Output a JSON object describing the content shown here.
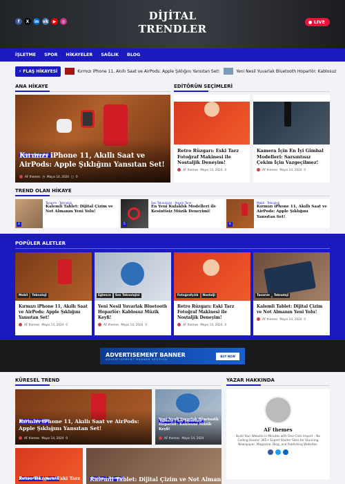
{
  "header": {
    "logo_line1": "DİJİTAL",
    "logo_line2": "TRENDLER",
    "live": "LIVE",
    "social": [
      "f",
      "X",
      "in",
      "vk",
      "▶",
      "◎"
    ]
  },
  "nav": [
    "İŞLETME",
    "SPOR",
    "HİKAYELER",
    "SAĞLIK",
    "BLOG"
  ],
  "ticker": {
    "label": "⚡ FLAŞ HİKAYESİ",
    "items": [
      "Kırmızı iPhone 11, Akıllı Saat ve AirPods: Apple Şıklığını Yansıtan Set!",
      "Yeni Nesil Yuvarlak Bluetooth Hoparlör: Kablosuz"
    ]
  },
  "sections": {
    "main_story": "ANA HİKAYE",
    "editors": "EDİTÖRÜN SEÇİMLERİ",
    "trending": "TREND OLAN HİKAYE",
    "popular": "POPÜLER ALETLER",
    "global": "KÜRESEL TREND",
    "about": "YAZAR HAKKINDA"
  },
  "main": {
    "cats": [
      "Mobil",
      "Teknoloji"
    ],
    "title": "Kırmızı iPhone 11, Akıllı Saat ve AirPods: Apple Şıklığını Yansıtan Set!",
    "author": "AF themes",
    "date": "Mayıs 14, 2024",
    "comments": "0"
  },
  "editors": [
    {
      "title": "Retro Rüzgarı: Eski Tarz Fotoğraf Makinesi ile Nostaljik Deneyim!",
      "author": "AF themes",
      "date": "Mayıs 14, 2024",
      "comments": "0"
    },
    {
      "title": "Kamera İçin En İyi Gimbal Modelleri: Sarsıntısız Çekim İçin Vazgeçilmez!",
      "author": "AF themes",
      "date": "Mayıs 14, 2024",
      "comments": "0"
    }
  ],
  "trending": [
    {
      "num": "4",
      "cats": "Tasarım · Teknoloji",
      "title": "Kalemli Tablet: Dijital Çizim ve Not Almanın Yeni Yolu!"
    },
    {
      "num": "5",
      "cats": "Ses Teknolojisi · Yaşam Tarzı",
      "title": "En Yeni Kulaklık Modelleri ile Kesintisiz Müzik Deneyimi!"
    },
    {
      "num": "6",
      "cats": "Mobil · Teknoloji",
      "title": "Kırmızı iPhone 11, Akıllı Saat ve AirPods: Apple Şıklığını Yansıtan Set!"
    }
  ],
  "popular": [
    {
      "cats": [
        "Mobil",
        "Teknoloji"
      ],
      "title": "Kırmızı iPhone 11, Akıllı Saat ve AirPods: Apple Şıklığını Yansıtan Set!",
      "author": "AF themes",
      "date": "Mayıs 14, 2024",
      "comments": "0"
    },
    {
      "cats": [
        "Eğlence",
        "Ses Teknolojisi"
      ],
      "title": "Yeni Nesil Yuvarlak Bluetooth Hoparlör: Kablosuz Müzik Keyfi!",
      "author": "AF themes",
      "date": "Mayıs 14, 2024",
      "comments": "0"
    },
    {
      "cats": [
        "Fotoğrafçılık",
        "Nostalji"
      ],
      "title": "Retro Rüzgarı: Eski Tarz Fotoğraf Makinesi ile Nostaljik Deneyim!",
      "author": "AF themes",
      "date": "Mayıs 14, 2024",
      "comments": "0"
    },
    {
      "cats": [
        "Tasarım",
        "Teknoloji"
      ],
      "title": "Kalemli Tablet: Dijital Çizim ve Not Almanın Yeni Yolu!",
      "author": "AF themes",
      "date": "Mayıs 14, 2024",
      "comments": "0"
    }
  ],
  "ad": {
    "title": "ADVERTISEMENT BANNER",
    "sub": "ADVERTISEMENT BANNER SECTION",
    "btn": "BUY NOW"
  },
  "global": [
    {
      "cats": [
        "Mobil",
        "Teknoloji"
      ],
      "title": "Kırmızı iPhone 11, Akıllı Saat ve AirPods: Apple Şıklığını Yansıtan Set!",
      "author": "AF themes",
      "date": "Mayıs 14, 2024",
      "comments": "0"
    },
    {
      "cats": [
        "Eğlence",
        "Ses Teknolojisi"
      ],
      "title": "Yeni Nesil Yuvarlak Bluetooth Hoparlör: Kablosuz Müzik Keyfi!",
      "author": "AF themes",
      "date": "Mayıs 14, 2024",
      "comments": "0"
    },
    {
      "cats": [
        "Fotoğrafçılık",
        "Nostalji"
      ],
      "title": "Retro Rüzgarı: Eski Tarz"
    },
    {
      "cats": [
        "Tasarım",
        "Teknoloji"
      ],
      "title": "Kalemli Tablet: Dijital Çizim ve Not Almanın"
    }
  ],
  "about": {
    "name": "AF themes",
    "bio": "Build Your Website in Minutes with One-Click Import – No Coding Hassle! 365+ Expert Starter Sites for Stunning Newspaper, Magazine, Blog, and Publishing Websites."
  }
}
